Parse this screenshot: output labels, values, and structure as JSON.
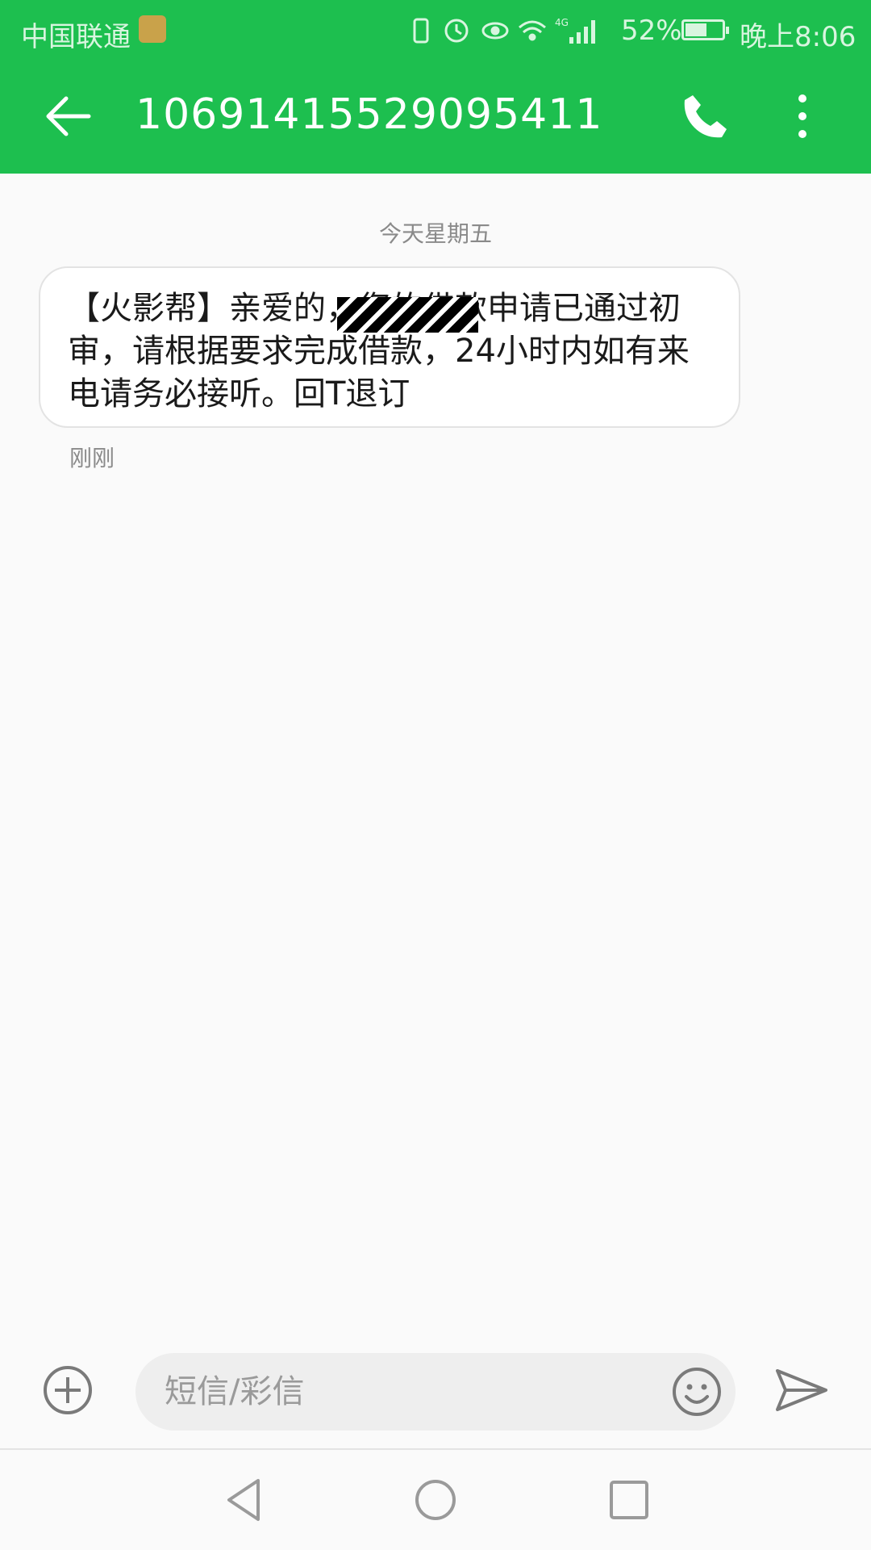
{
  "status_bar": {
    "carrier": "中国联通",
    "battery_percent": "52%",
    "time": "晚上8:06",
    "network": "4G"
  },
  "header": {
    "title": "10691415529095411"
  },
  "conversation": {
    "date_separator": "今天星期五",
    "message_text": "【火影帮】亲爱的，您的借款申请已通过初审，请根据要求完成借款，24小时内如有来电请务必接听。回T退订",
    "message_time": "刚刚"
  },
  "composer": {
    "placeholder": "短信/彩信"
  },
  "colors": {
    "accent": "#1dbf4f"
  }
}
